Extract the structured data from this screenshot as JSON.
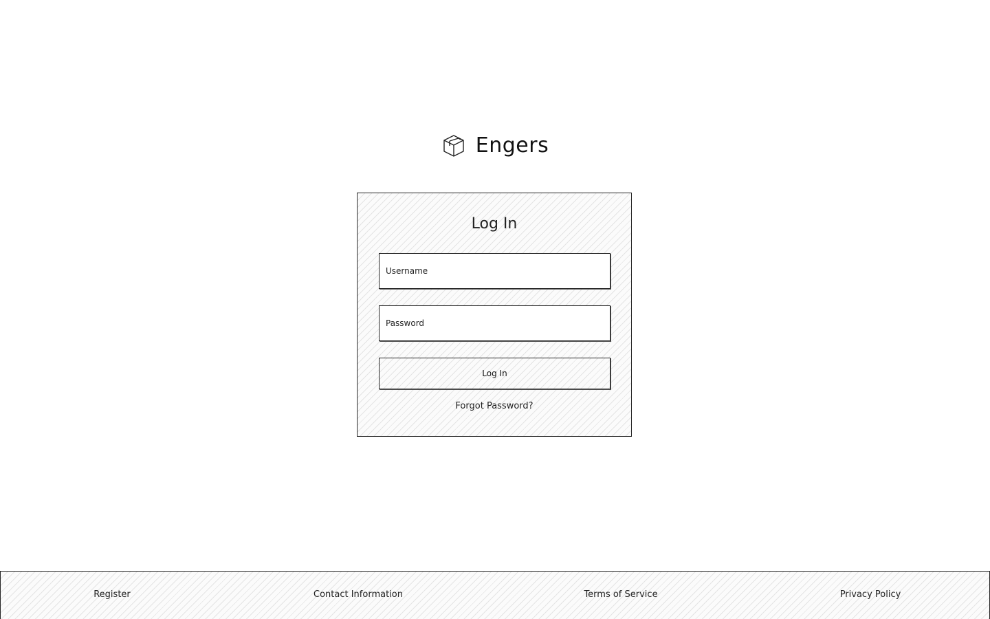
{
  "brand": {
    "name": "Engers",
    "icon": "cube-icon"
  },
  "login": {
    "title": "Log In",
    "username_placeholder": "Username",
    "password_placeholder": "Password",
    "submit_label": "Log In",
    "forgot_label": "Forgot Password?"
  },
  "footer": {
    "links": [
      {
        "label": "Register"
      },
      {
        "label": "Contact Information"
      },
      {
        "label": "Terms of Service"
      },
      {
        "label": "Privacy Policy"
      }
    ]
  },
  "colors": {
    "stroke": "#222222",
    "background": "#ffffff"
  }
}
